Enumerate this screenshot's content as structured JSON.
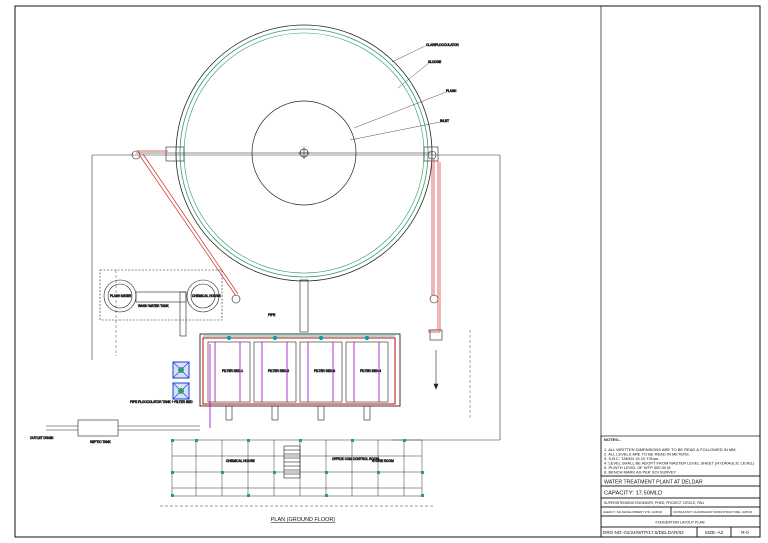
{
  "drawing": {
    "plan_caption": "PLAN (GROUND FLOOR)",
    "labels": {
      "clarifier_main": "CLARIFLOCCULATOR",
      "clarifier_a": "SLUDGE",
      "clarifier_b": "FLASH",
      "clarifier_c": "INLET",
      "left_tank_1": "FLASH MIXER",
      "left_tank_2": "CHEMICAL HOUSE",
      "washwater": "WASH WATER TANK",
      "filter_1": "FILTER BED-1",
      "filter_2": "FILTER BED-2",
      "filter_3": "FILTER BED-3",
      "filter_4": "FILTER BED-4",
      "pipe_label": "PIPE FLOCCULATOR TANK + FILTER BED",
      "outlet_left": "OUTLET DRAIN",
      "septic": "SEPTIC TANK",
      "chemical_house": "CHEMICAL HOUSE",
      "office_control": "OFFICE CUM CONTROL ROOM",
      "store_room": "STORE ROOM"
    }
  },
  "title_block": {
    "notes_heading": "NOTES:-",
    "notes": [
      "1. ALL WRITTEN DIMENSIONS ARE TO BE READ & FOLLOWED IN MM.",
      "2. ALL LEVELS ARE TO BE READ IN METERS.",
      "3. S.B.C. TAKEN 15.10 T/Sqm.",
      "4. LEVEL SHALL BE ADOPT FROM MASTER LEVEL SHEET (HYDRAULIC LEVEL)",
      "5. PLINTH LEVEL OF WTP 300.00 M",
      "6. BENCH MARK AS PER SOI SURVEY"
    ],
    "project_title": "WATER TREATMENT PLANT AT DELDAR",
    "capacity": "CAPACITY: 17.50MLD",
    "authority": "SUPERINTENDING ENGINEER, PHED, PROJECT CIRCLE, PALI",
    "agency": "AGENCY: SAI DEVELOPMENT LTD. JAIPUR",
    "consultant": "CONSULTANT: CHOWDHARY INFRASTRUCTURE, JAIPUR",
    "drawing_title": "FOUNDATION LAYOUT PLAN",
    "drg_no": "DRG NO:-01/24/WTP/17.5/DELDAR/02",
    "size": "SIZE- A2",
    "rev": "R-0"
  },
  "colors": {
    "line": "#222222",
    "red": "#d0302a",
    "green": "#2e9e68",
    "magenta": "#a000c8",
    "blue": "#1e3cd2",
    "cyan": "#00a0a0"
  }
}
